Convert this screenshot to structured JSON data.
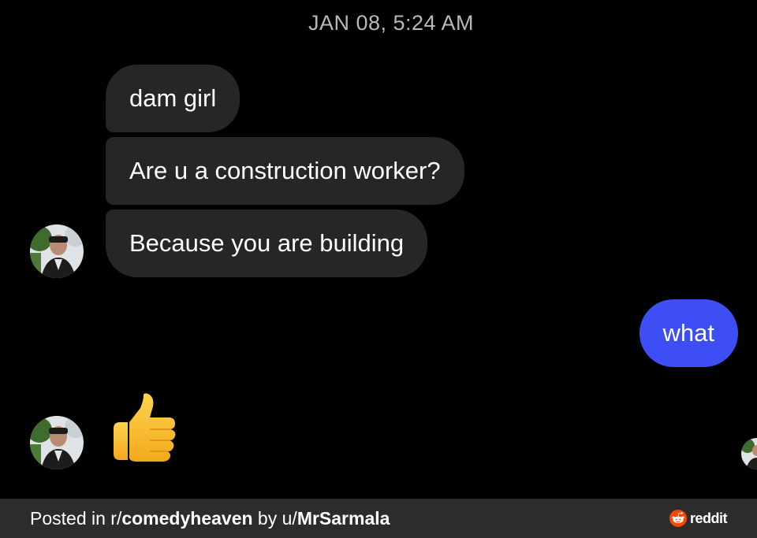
{
  "conversation": {
    "timestamp": "JAN 08, 5:24 AM",
    "incoming": [
      "dam girl",
      "Are u a construction worker?",
      "Because you are building"
    ],
    "outgoing": [
      "what"
    ],
    "reaction_icon": "thumbs-up-emoji"
  },
  "footer": {
    "prefix": "Posted in r/",
    "subreddit": "comedyheaven",
    "by": " by u/",
    "user": "MrSarmala",
    "brand": "reddit"
  },
  "colors": {
    "background": "#000000",
    "incoming_bubble": "#262626",
    "outgoing_bubble": "#3d4ef5",
    "footer_bar": "#2c2c2c",
    "reddit_orange": "#ff4500"
  }
}
